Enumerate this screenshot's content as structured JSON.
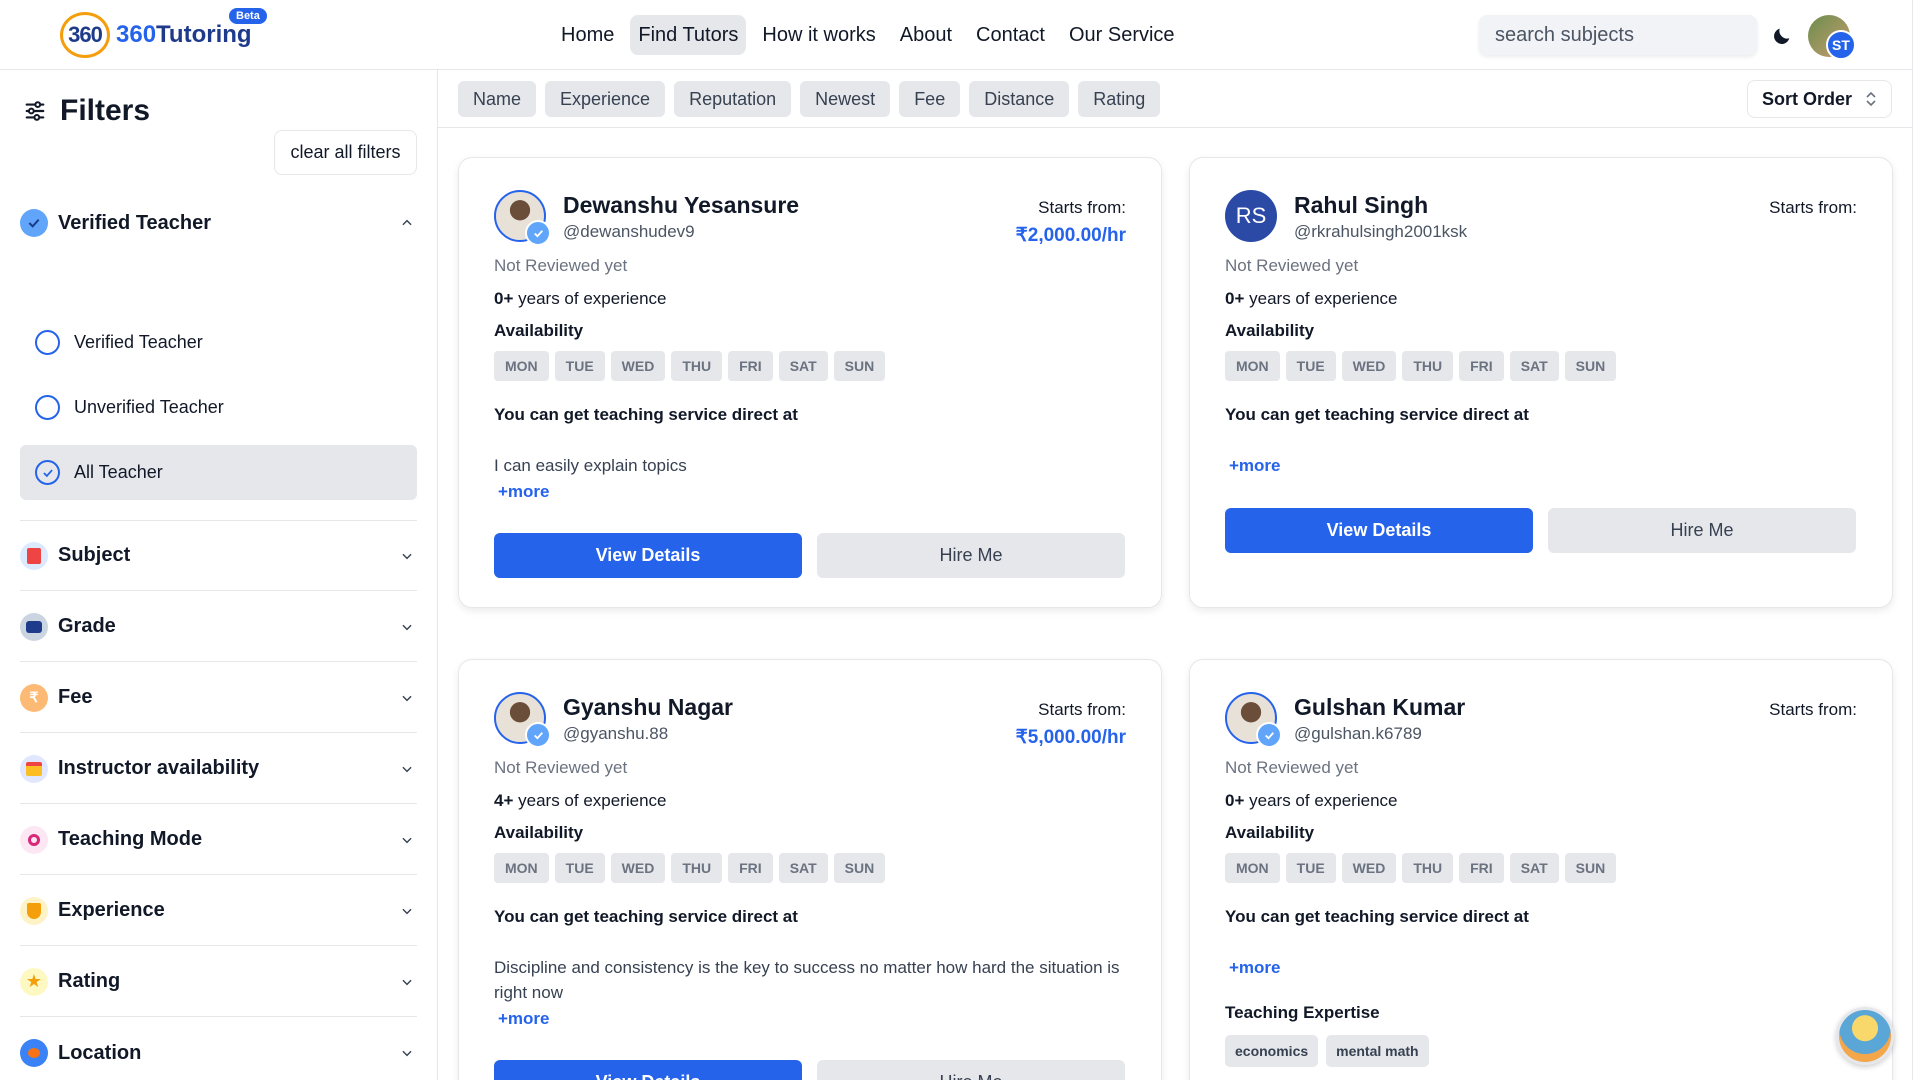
{
  "header": {
    "logo_num": "360",
    "logo_text": "Tutoring",
    "beta": "Beta",
    "nav": [
      "Home",
      "Find Tutors",
      "How it works",
      "About",
      "Contact",
      "Our Service"
    ],
    "search_placeholder": "search subjects",
    "avatar_initials": "ST"
  },
  "sidebar": {
    "title": "Filters",
    "clear_label": "clear all filters",
    "verified": {
      "label": "Verified Teacher",
      "options": [
        "Verified Teacher",
        "Unverified Teacher",
        "All Teacher"
      ],
      "selected": "All Teacher"
    },
    "sections": [
      "Subject",
      "Grade",
      "Fee",
      "Instructor availability",
      "Teaching Mode",
      "Experience",
      "Rating",
      "Location"
    ]
  },
  "sortbar": {
    "chips": [
      "Name",
      "Experience",
      "Reputation",
      "Newest",
      "Fee",
      "Distance",
      "Rating"
    ],
    "sort_order": "Sort Order"
  },
  "labels": {
    "starts_from": "Starts from:",
    "years_exp": "years of experience",
    "availability": "Availability",
    "direct": "You can get teaching service direct at",
    "more": "+more",
    "view_details": "View Details",
    "hire_me": "Hire Me",
    "teaching_expertise": "Teaching Expertise",
    "days": [
      "MON",
      "TUE",
      "WED",
      "THU",
      "FRI",
      "SAT",
      "SUN"
    ]
  },
  "tutors": [
    {
      "name": "Dewanshu Yesansure",
      "username": "@dewanshudev9",
      "review": "Not Reviewed yet",
      "experience": "0+",
      "price": "₹2,000.00/hr",
      "description": "I can easily explain topics"
    },
    {
      "name": "Rahul Singh",
      "username": "@rkrahulsingh2001ksk",
      "initials": "RS",
      "review": "Not Reviewed yet",
      "experience": "0+",
      "price": "",
      "description": ""
    },
    {
      "name": "Gyanshu Nagar",
      "username": "@gyanshu.88",
      "review": "Not Reviewed yet",
      "experience": "4+",
      "price": "₹5,000.00/hr",
      "description": "Discipline and consistency is the key to success no matter how hard the situation is right now"
    },
    {
      "name": "Gulshan Kumar",
      "username": "@gulshan.k6789",
      "review": "Not Reviewed yet",
      "experience": "0+",
      "price": "",
      "description": "",
      "expertise": [
        "economics",
        "mental math"
      ]
    }
  ],
  "colors": {
    "accent": "#2563eb",
    "chip_bg": "#e5e7eb",
    "text": "#111827"
  }
}
